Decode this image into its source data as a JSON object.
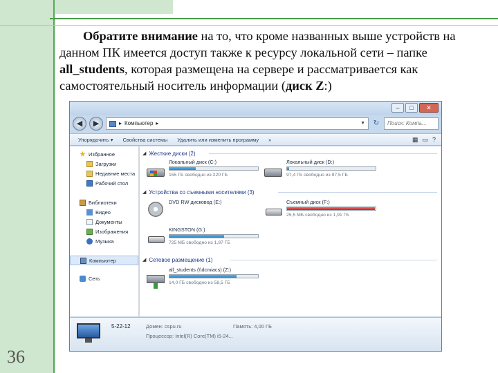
{
  "slide": {
    "number": "36",
    "paragraph": {
      "bold1": "Обратите внимание",
      "text1": " на то, что кроме названных выше устройств на данном ПК имеется доступ также к ресурсу локальной сети – папке ",
      "bold2": "all_students",
      "text2": ", которая размещена на сервере и рассматривается как самостоятельный носитель информации (",
      "bold3": "диск Z",
      "text3": ":)"
    }
  },
  "window": {
    "caption_buttons": [
      "–",
      "□",
      "✕"
    ],
    "address": {
      "path": "Компьютер",
      "search_placeholder": "Поиск: Компь..."
    },
    "toolbar": {
      "items": [
        "Упорядочить ▾",
        "Свойства системы",
        "Удалить или изменить программу",
        "»"
      ]
    },
    "nav": {
      "favorites": "Избранное",
      "downloads": "Загрузки",
      "recent": "Недавние места",
      "desktop": "Рабочий стол",
      "libraries": "Библиотеки",
      "video": "Видео",
      "documents": "Документы",
      "images": "Изображения",
      "music": "Музыка",
      "computer": "Компьютер",
      "network": "Сеть"
    },
    "groups": {
      "hdd": "Жесткие диски (2)",
      "removable": "Устройства со съемными носителями (3)",
      "network": "Сетевое размещение (1)"
    },
    "drives": [
      {
        "name": "Локальный диск (C:)",
        "free": "155 ГБ свободно из 220 ГБ",
        "used": 0.3,
        "color": "blue"
      },
      {
        "name": "Локальный диск (D:)",
        "free": "97,4 ГБ свободно из 97,5 ГБ",
        "used": 0.02,
        "color": "blue"
      },
      {
        "name": "DVD RW дисковод (E:)",
        "free": "",
        "used": 0,
        "color": "none"
      },
      {
        "name": "Съемный диск (F:)",
        "free": "25,5 МБ свободно из 1,91 ГБ",
        "used": 0.99,
        "color": "red"
      },
      {
        "name": "KINGSTON (G:)",
        "free": "725 МБ свободно из 1,87 ГБ",
        "used": 0.62,
        "color": "blue"
      },
      {
        "name": "all_students (\\\\dcmiacs) (Z:)",
        "free": "14,0 ГБ свободно из 58,5 ГБ",
        "used": 0.76,
        "color": "blue"
      }
    ],
    "details": {
      "name": "5-22-12",
      "domain": "Домен: cspu.ru",
      "memory": "Память: 4,00 ГБ",
      "processor": "Процессор: Intel(R) Core(TM) i5-24..."
    }
  }
}
